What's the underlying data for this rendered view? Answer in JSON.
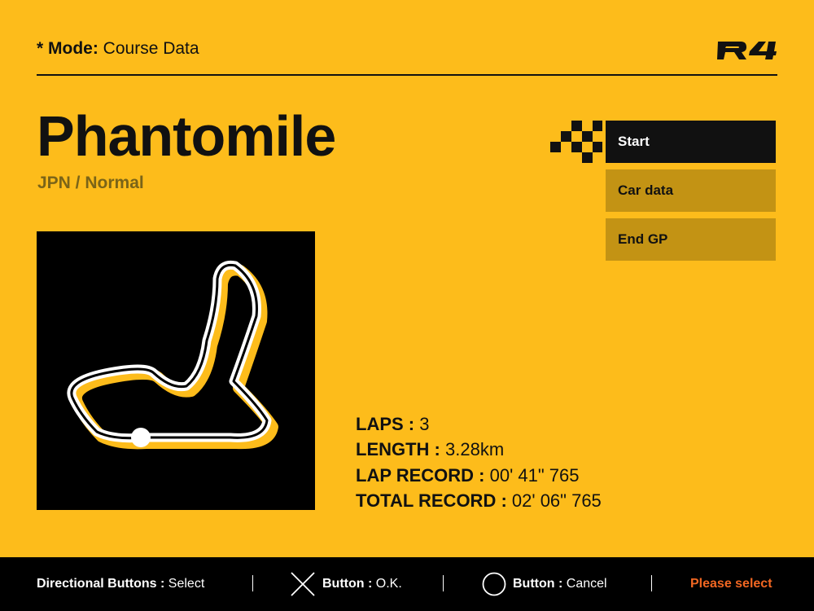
{
  "header": {
    "mode_label": "* Mode:",
    "mode_value": "Course Data",
    "logo_text": "R4"
  },
  "course": {
    "name": "Phantomile",
    "subtitle": "JPN / Normal"
  },
  "menu": {
    "items": [
      {
        "label": "Start",
        "selected": true
      },
      {
        "label": "Car data",
        "selected": false
      },
      {
        "label": "End GP",
        "selected": false
      }
    ]
  },
  "stats": {
    "laps_label": "LAPS :",
    "laps_value": "3",
    "length_label": "LENGTH :",
    "length_value": "3.28km",
    "lap_record_label": "LAP RECORD :",
    "lap_record_value": "00' 41\" 765",
    "total_record_label": "TOTAL RECORD :",
    "total_record_value": "02' 06\" 765"
  },
  "footer": {
    "directional_label": "Directional Buttons :",
    "directional_value": "Select",
    "cross_label": "Button :",
    "cross_value": "O.K.",
    "circle_label": "Button :",
    "circle_value": "Cancel",
    "status": "Please select"
  },
  "colors": {
    "background": "#FDBC1B",
    "panel": "#000000",
    "menu_selected": "#111111",
    "menu_normal": "#C39314",
    "status": "#F26722",
    "track_shadow": "#FDBC1B",
    "track": "#FFFFFF"
  },
  "icons": {
    "cross": "cross-button-icon",
    "circle": "circle-button-icon",
    "checker": "checkered-flag-icon"
  }
}
